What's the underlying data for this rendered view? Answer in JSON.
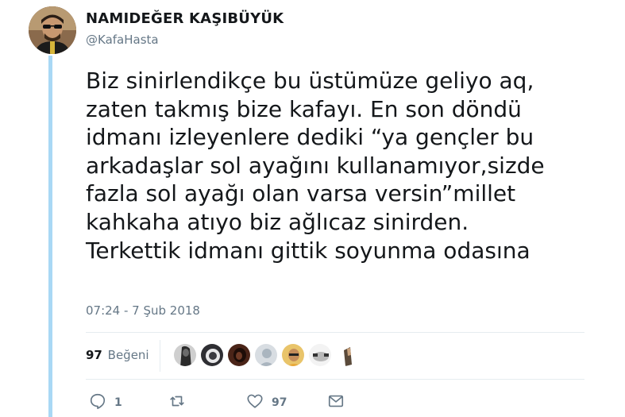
{
  "tweet": {
    "display_name": "NAMIDEĞER KAŞIBÜYÜK",
    "handle": "@KafaHasta",
    "text": "Biz sinirlendikçe bu üstümüze geliyo aq,\nzaten takmış bize kafayı. En son döndü\nidmanı izleyenlere dediki “ya gençler bu\narkadaşlar sol ayağını kullanamıyor,sizde\nfazla sol ayağı olan varsa versin”millet\nkahkaha atıyo biz ağlıcaz sinirden.\nTerkettik idmanı gittik soyunma odasına",
    "timestamp": "07:24 - 7 Şub 2018"
  },
  "likes": {
    "count": "97",
    "label": "Beğeni"
  },
  "actions": {
    "reply_count": "1",
    "retweet_count": "",
    "like_count": "97"
  },
  "colors": {
    "thread_line": "#a9d8f5",
    "text": "#14171a",
    "secondary": "#657786",
    "divider": "#e6ecf0"
  },
  "icons": [
    "reply-icon",
    "retweet-icon",
    "heart-icon",
    "envelope-icon"
  ]
}
